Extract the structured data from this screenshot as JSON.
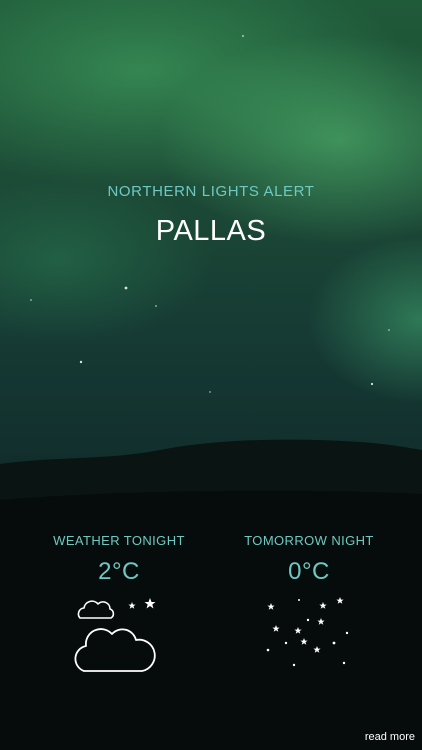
{
  "alert": {
    "label": "NORTHERN LIGHTS ALERT",
    "location": "PALLAS"
  },
  "forecast": {
    "tonight": {
      "label": "WEATHER TONIGHT",
      "temperature": "2°C",
      "icon": "partly-cloudy-night-icon"
    },
    "tomorrow": {
      "label": "TOMORROW NIGHT",
      "temperature": "0°C",
      "icon": "clear-night-stars-icon"
    }
  },
  "footer": {
    "read_more": "read more"
  },
  "colors": {
    "accent": "#6fc9c2",
    "text": "#ffffff",
    "background": "#050b0a"
  }
}
